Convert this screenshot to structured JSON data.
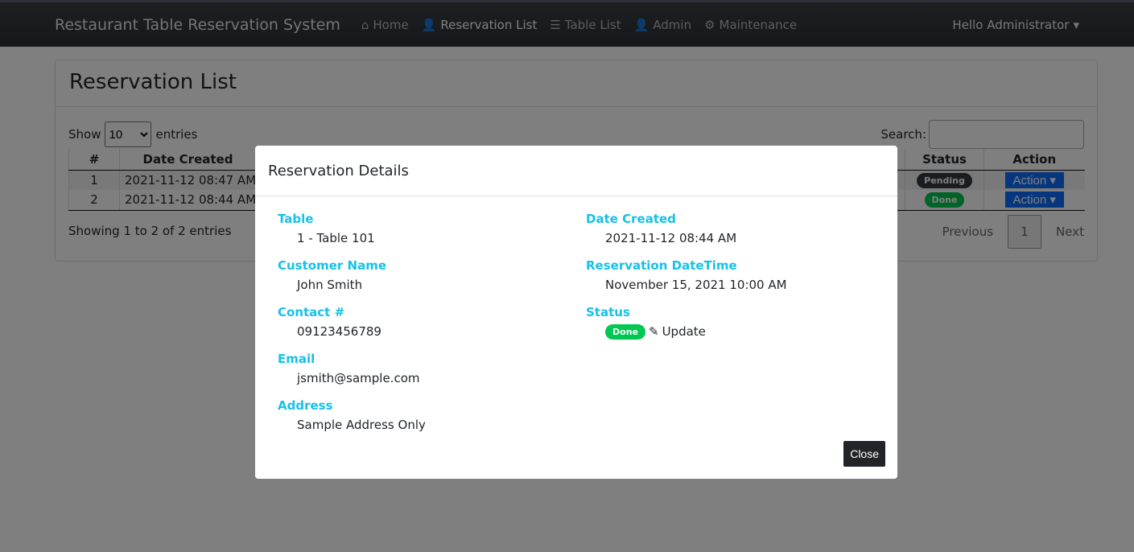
{
  "nav": {
    "brand": "Restaurant Table Reservation System",
    "items": [
      {
        "label": "Home",
        "icon": "home-icon"
      },
      {
        "label": "Reservation List",
        "icon": "user-clock-icon",
        "active": true
      },
      {
        "label": "Table List",
        "icon": "list-icon"
      },
      {
        "label": "Admin",
        "icon": "user-cog-icon"
      },
      {
        "label": "Maintenance",
        "icon": "cogs-icon"
      }
    ],
    "user": "Hello Administrator"
  },
  "page": {
    "title": "Reservation List",
    "show": "Show",
    "entries_value": "10",
    "entries": "entries",
    "search": "Search:",
    "columns": [
      "#",
      "Date Created",
      "Status",
      "Action"
    ],
    "rows": [
      {
        "n": "1",
        "date": "2021-11-12 08:47 AM",
        "status": "Pending",
        "action": "Action"
      },
      {
        "n": "2",
        "date": "2021-11-12 08:44 AM",
        "status": "Done",
        "action": "Action"
      }
    ],
    "info": "Showing 1 to 2 of 2 entries",
    "prev": "Previous",
    "page": "1",
    "next": "Next"
  },
  "modal": {
    "title": "Reservation Details",
    "table_label": "Table",
    "table": "1 - Table 101",
    "customer_label": "Customer Name",
    "customer": "John Smith",
    "contact_label": "Contact #",
    "contact": "09123456789",
    "email_label": "Email",
    "email": "jsmith@sample.com",
    "address_label": "Address",
    "address": "Sample Address Only",
    "created_label": "Date Created",
    "created": "2021-11-12 08:44 AM",
    "resdt_label": "Reservation DateTime",
    "resdt": "November 15, 2021 10:00 AM",
    "status_label": "Status",
    "status": "Done",
    "update": "Update",
    "close": "Close"
  },
  "colors": {
    "accent": "#17c1e8",
    "done": "#00c851",
    "action": "#0d6efd"
  }
}
